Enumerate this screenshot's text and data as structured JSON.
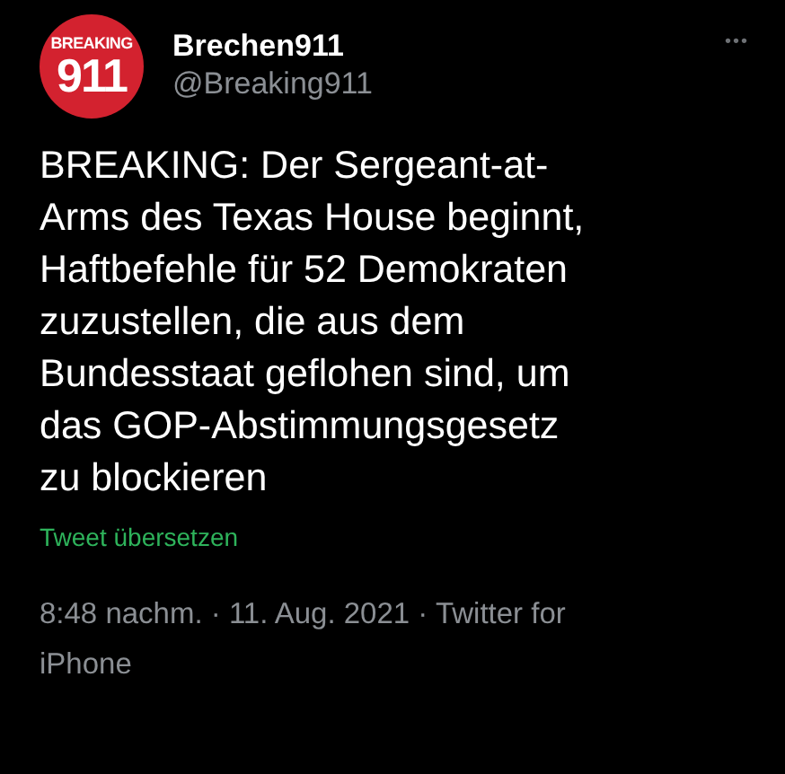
{
  "author": {
    "avatar_text": [
      "BREAKING",
      "911"
    ],
    "name": "Brechen911",
    "handle": "@Breaking911"
  },
  "more": "•••",
  "body": "BREAKING: Der Sergeant-at-\nArms des Texas House beginnt,\nHaftbefehle für 52 Demokraten\nzuzustellen, die aus dem\nBundesstaat geflohen sind, um\ndas GOP-Abstimmungsgesetz\nzu blockieren",
  "translate": "Tweet übersetzen",
  "meta": "8:48 nachm. · 11. Aug. 2021 · Twitter for\niPhone"
}
